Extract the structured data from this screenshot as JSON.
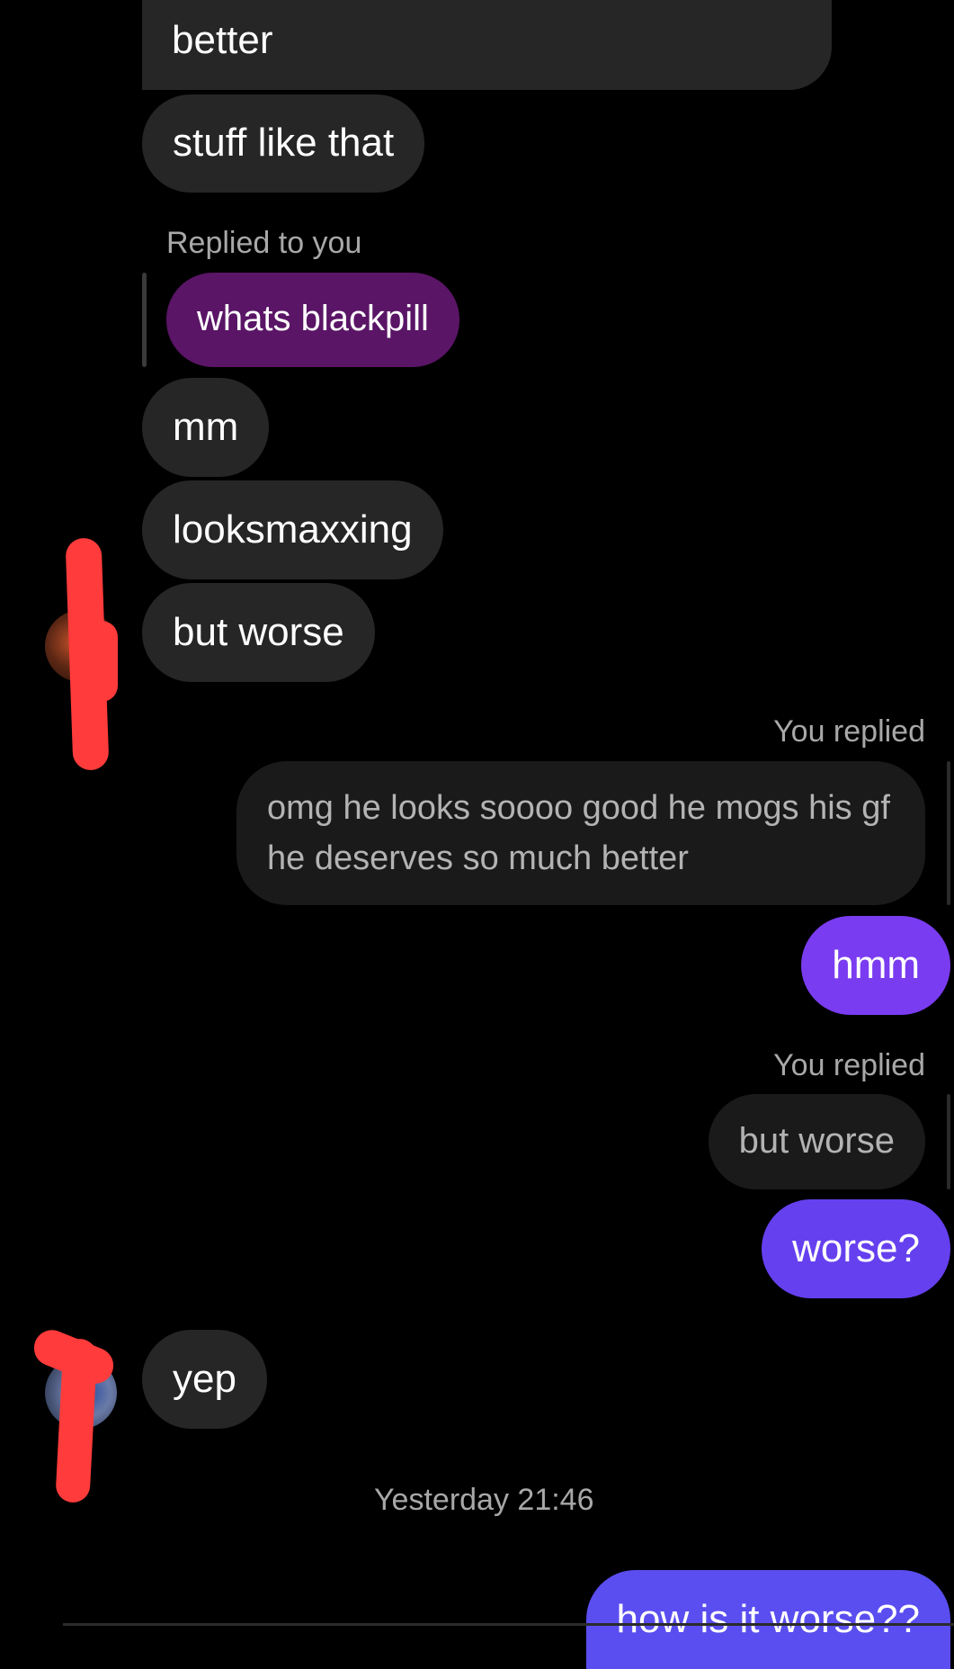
{
  "colors": {
    "background": "#000000",
    "incoming_bubble": "#262626",
    "quoted_purple": "#5a1566",
    "outgoing_purple_1": "#7a3cf0",
    "outgoing_purple_2": "#6540ef",
    "outgoing_purple_3": "#5a4ef0",
    "redaction": "#ff3b3b",
    "secondary_text": "#a8a8a8"
  },
  "messages": {
    "m1": "better",
    "m2": "stuff like that",
    "reply_label_1": "Replied to you",
    "quoted_1": "whats blackpill",
    "m3": "mm",
    "m4": "looksmaxxing",
    "m5": "but worse",
    "reply_label_2": "You replied",
    "quoted_2": "omg he looks soooo good he mogs his gf he deserves so much better",
    "m6": "hmm",
    "reply_label_3": "You replied",
    "quoted_3": "but worse",
    "m7": "worse?",
    "m8": "yep",
    "timestamp": "Yesterday 21:46",
    "m9": "how is it worse??"
  },
  "icons": {
    "avatar_1": "contact-avatar-icon",
    "avatar_2": "contact-avatar-icon"
  }
}
